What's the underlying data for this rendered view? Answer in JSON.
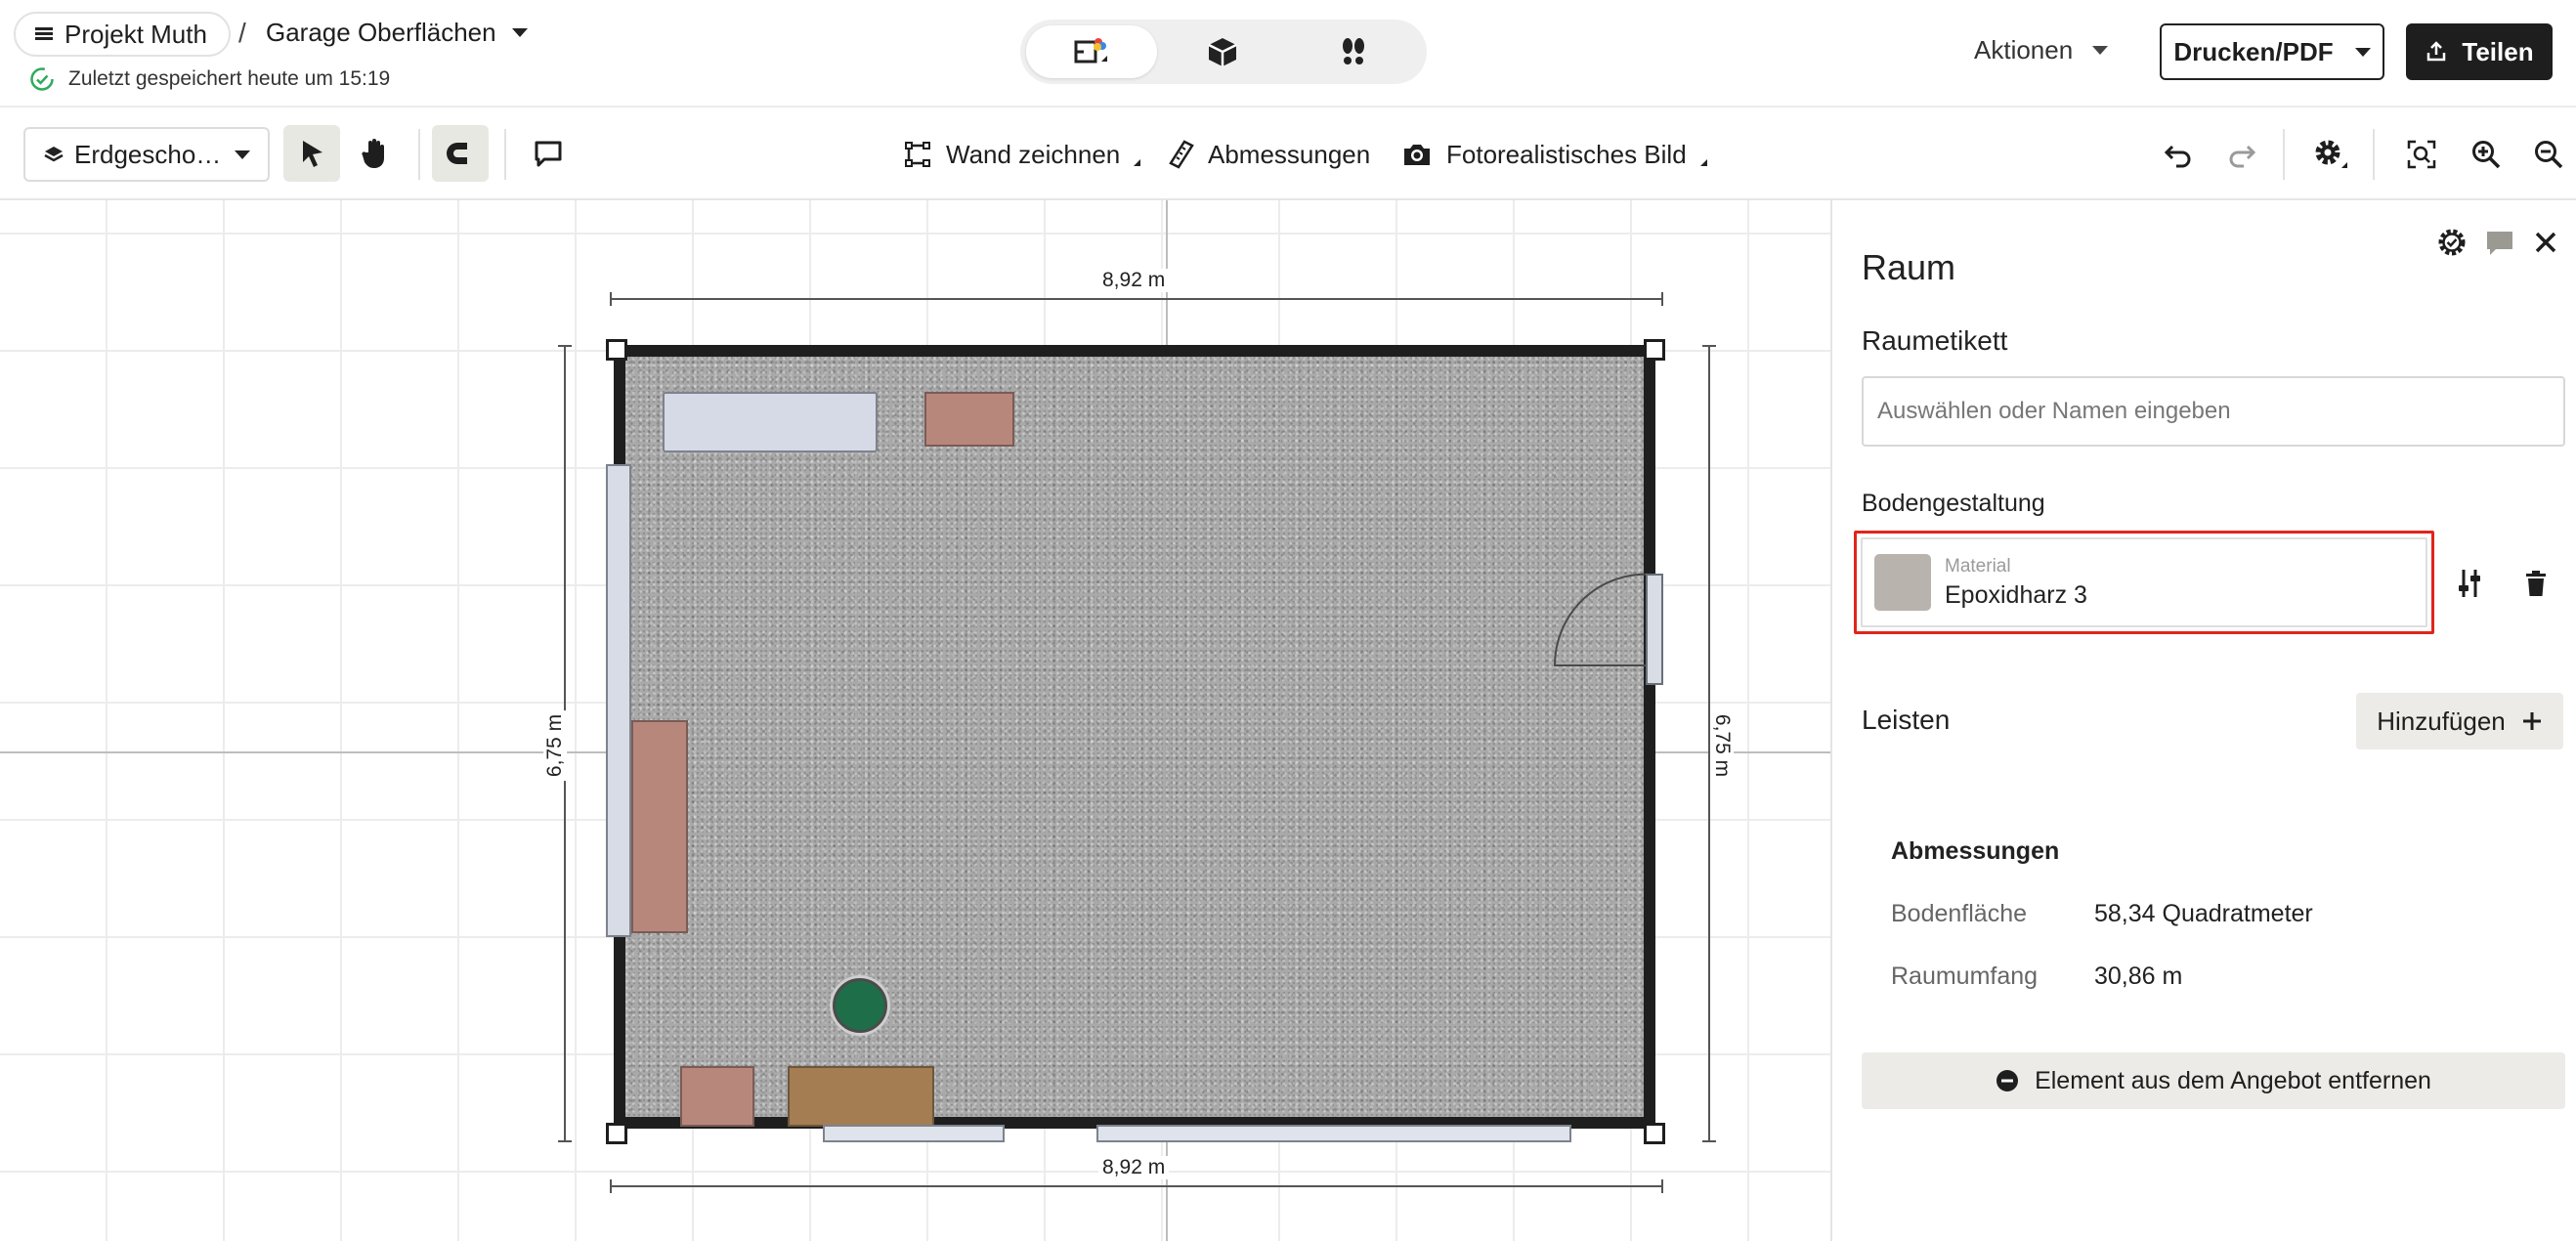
{
  "header": {
    "project_name": "Projekt Muth",
    "separator": "/",
    "plan_name": "Garage Oberflächen",
    "saved_status": "Zuletzt gespeichert heute um 15:19",
    "view_modes": [
      "2d-plan-icon",
      "3d-box-icon",
      "walk-footsteps-icon"
    ],
    "actions_label": "Aktionen",
    "print_label": "Drucken/PDF",
    "share_label": "Teilen"
  },
  "toolbar": {
    "floor_label": "Erdgescho…",
    "draw_wall_label": "Wand zeichnen",
    "dimensions_label": "Abmessungen",
    "photo_label": "Fotorealistisches Bild"
  },
  "canvas": {
    "dim_top": "8,92 m",
    "dim_bottom": "8,92 m",
    "dim_left": "6,75 m",
    "dim_right": "6,75 m"
  },
  "panel": {
    "title": "Raum",
    "room_label_heading": "Raumetikett",
    "room_label_placeholder": "Auswählen oder Namen eingeben",
    "floor_heading": "Bodengestaltung",
    "material_caption": "Material",
    "material_name": "Epoxidharz 3",
    "material_swatch_color": "#b9b3ae",
    "skirting_heading": "Leisten",
    "add_label": "Hinzufügen",
    "dimensions_heading": "Abmessungen",
    "floor_area_label": "Bodenfläche",
    "floor_area_value": "58,34 Quadratmeter",
    "perimeter_label": "Raumumfang",
    "perimeter_value": "30,86 m",
    "remove_label": "Element aus dem Angebot entfernen"
  },
  "colors": {
    "highlight_red": "#e0251b",
    "primary_dark": "#1e1e1e",
    "saved_green": "#2eaa5c"
  }
}
